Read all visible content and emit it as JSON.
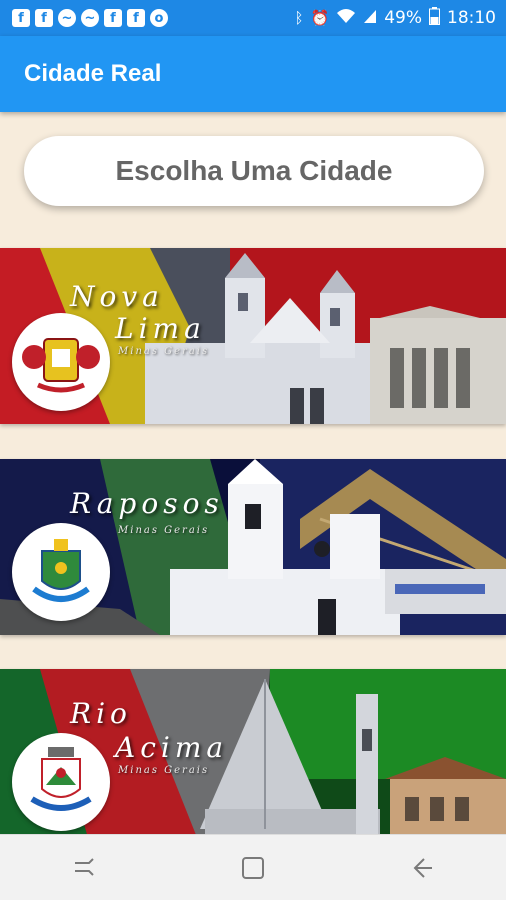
{
  "status_bar": {
    "notification_icons": [
      {
        "icon": "facebook-icon",
        "glyph": "f"
      },
      {
        "icon": "facebook-icon",
        "glyph": "f"
      },
      {
        "icon": "messenger-icon",
        "glyph": "~"
      },
      {
        "icon": "messenger-icon",
        "glyph": "~"
      },
      {
        "icon": "facebook-icon",
        "glyph": "f"
      },
      {
        "icon": "facebook-icon",
        "glyph": "f"
      },
      {
        "icon": "eye-icon",
        "glyph": "o"
      }
    ],
    "battery": "49%",
    "time": "18:10"
  },
  "app_bar": {
    "title": "Cidade Real"
  },
  "pick_button": {
    "label": "Escolha Uma Cidade"
  },
  "cities": [
    {
      "name_line1": "Nova",
      "name_line2": "Lima",
      "state": "Minas Gerais",
      "emblem_icon": "nova-lima-coat-of-arms-icon"
    },
    {
      "name_line1": "Raposos",
      "name_line2": "",
      "state": "Minas Gerais",
      "emblem_icon": "raposos-coat-of-arms-icon"
    },
    {
      "name_line1": "Rio",
      "name_line2": "Acima",
      "state": "Minas Gerais",
      "emblem_icon": "rio-acima-coat-of-arms-icon"
    }
  ],
  "colors": {
    "status_bar": "#1e88e5",
    "app_bar": "#2196f3",
    "background": "#f7ecdc"
  },
  "nav_bar": {
    "icons": [
      "recent-apps-icon",
      "home-icon",
      "back-icon"
    ]
  }
}
